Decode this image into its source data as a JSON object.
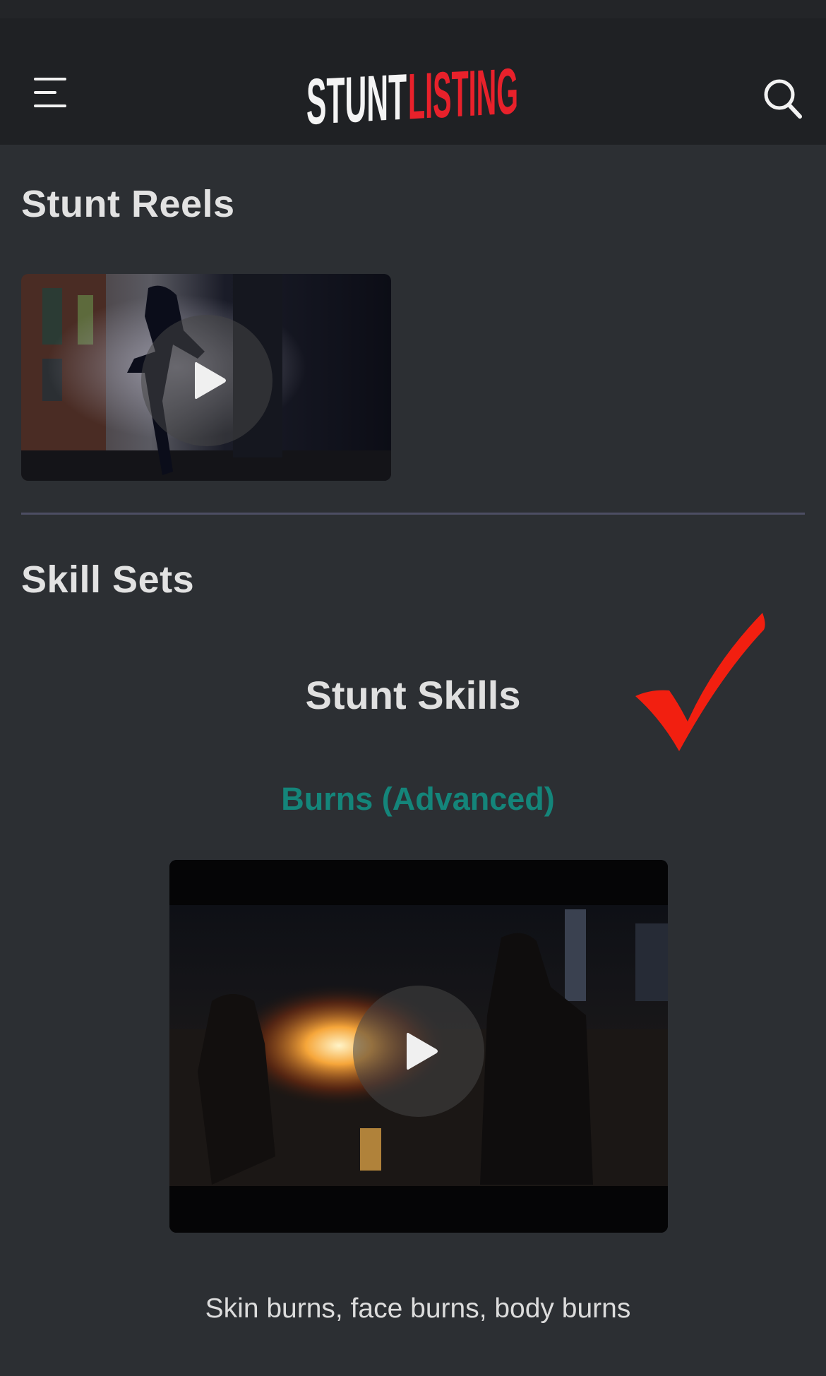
{
  "header": {
    "logo": {
      "part1": "STUNT",
      "part2": "LISTING"
    },
    "menu_icon": "hamburger-menu-icon",
    "search_icon": "search-icon"
  },
  "reels": {
    "title": "Stunt Reels",
    "thumbnail_icon": "play-icon"
  },
  "skills": {
    "title": "Skill Sets",
    "category": "Stunt Skills",
    "checkmark_icon": "checkmark-icon",
    "item": {
      "name": "Burns (Advanced)",
      "description": "Skin burns, face burns, body burns",
      "video_icon": "play-icon"
    }
  },
  "colors": {
    "background": "#2c2f33",
    "header": "#1f2124",
    "accent_red": "#e8212b",
    "link_teal": "#14857a",
    "divider": "#4d4e63"
  }
}
